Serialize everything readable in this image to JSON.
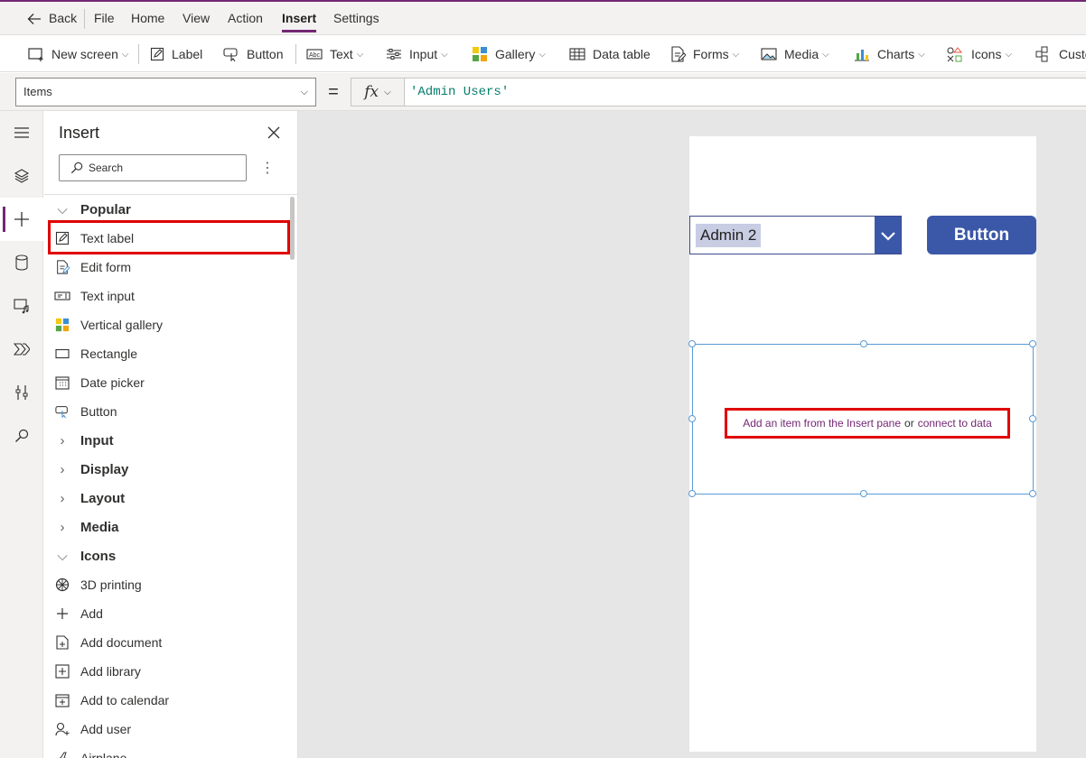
{
  "menu": {
    "back": "Back",
    "items": [
      "File",
      "Home",
      "View",
      "Action",
      "Insert",
      "Settings"
    ]
  },
  "toolbar": {
    "new_screen": "New screen",
    "label": "Label",
    "button": "Button",
    "text": "Text",
    "input": "Input",
    "gallery": "Gallery",
    "data_table": "Data table",
    "forms": "Forms",
    "media": "Media",
    "charts": "Charts",
    "icons": "Icons",
    "custom": "Custom"
  },
  "formula_bar": {
    "property": "Items",
    "equals": "=",
    "fx": "fx",
    "formula": "'Admin Users'"
  },
  "panel": {
    "title": "Insert",
    "search_placeholder": "Search",
    "rows": [
      {
        "type": "section",
        "label": "Popular",
        "expanded": true
      },
      {
        "type": "item",
        "label": "Text label",
        "icon": "edit-icon"
      },
      {
        "type": "item",
        "label": "Edit form",
        "icon": "form-icon"
      },
      {
        "type": "item",
        "label": "Text input",
        "icon": "text-input-icon"
      },
      {
        "type": "item",
        "label": "Vertical gallery",
        "icon": "gallery-icon"
      },
      {
        "type": "item",
        "label": "Rectangle",
        "icon": "rectangle-icon"
      },
      {
        "type": "item",
        "label": "Date picker",
        "icon": "calendar-icon"
      },
      {
        "type": "item",
        "label": "Button",
        "icon": "button-icon"
      },
      {
        "type": "section",
        "label": "Input",
        "expanded": false
      },
      {
        "type": "section",
        "label": "Display",
        "expanded": false
      },
      {
        "type": "section",
        "label": "Layout",
        "expanded": false
      },
      {
        "type": "section",
        "label": "Media",
        "expanded": false
      },
      {
        "type": "section",
        "label": "Icons",
        "expanded": true
      },
      {
        "type": "item",
        "label": "3D printing",
        "icon": "printing-3d-icon"
      },
      {
        "type": "item",
        "label": "Add",
        "icon": "plus-icon"
      },
      {
        "type": "item",
        "label": "Add document",
        "icon": "add-document-icon"
      },
      {
        "type": "item",
        "label": "Add library",
        "icon": "add-library-icon"
      },
      {
        "type": "item",
        "label": "Add to calendar",
        "icon": "add-calendar-icon"
      },
      {
        "type": "item",
        "label": "Add user",
        "icon": "add-user-icon"
      },
      {
        "type": "item",
        "label": "Airplane",
        "icon": "airplane-icon"
      }
    ]
  },
  "canvas": {
    "dropdown_value": "Admin 2",
    "button_label": "Button",
    "placeholder_link1": "Add an item from the Insert pane",
    "placeholder_or": "or",
    "placeholder_link2": "connect to data"
  },
  "colors": {
    "accent": "#742774",
    "button_blue": "#3b58a8",
    "highlight_red": "#e00000",
    "formula_teal": "#077d6c",
    "canvas_gray": "#e6e6e6"
  }
}
